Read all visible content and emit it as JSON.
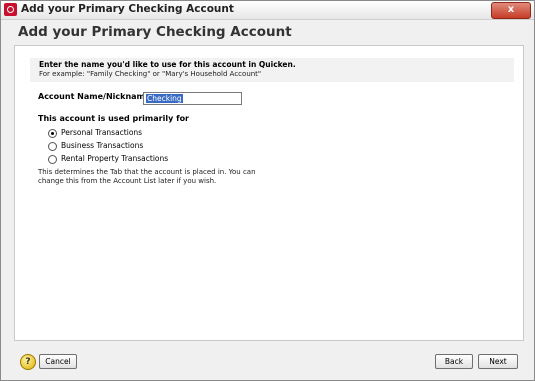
{
  "window": {
    "title": "Add your Primary Checking Account",
    "close_label": "x"
  },
  "header": {
    "title": "Add your Primary Checking Account"
  },
  "intro": {
    "instruction": "Enter the name you'd like to use for this account in Quicken.",
    "example": "For example: \"Family Checking\" or \"Mary's Household Account\""
  },
  "form": {
    "name_label": "Account Name/Nickname",
    "name_value": "Checking",
    "used_label": "This account is used primarily for",
    "options": [
      {
        "label": "Personal Transactions",
        "checked": true
      },
      {
        "label": "Business Transactions",
        "checked": false
      },
      {
        "label": "Rental Property Transactions",
        "checked": false
      }
    ],
    "help_text": "This determines the Tab that the account is placed in. You can change this from the Account List later if you wish."
  },
  "footer": {
    "help_icon_glyph": "?",
    "cancel_label": "Cancel",
    "back_label": "Back",
    "next_label": "Next"
  }
}
